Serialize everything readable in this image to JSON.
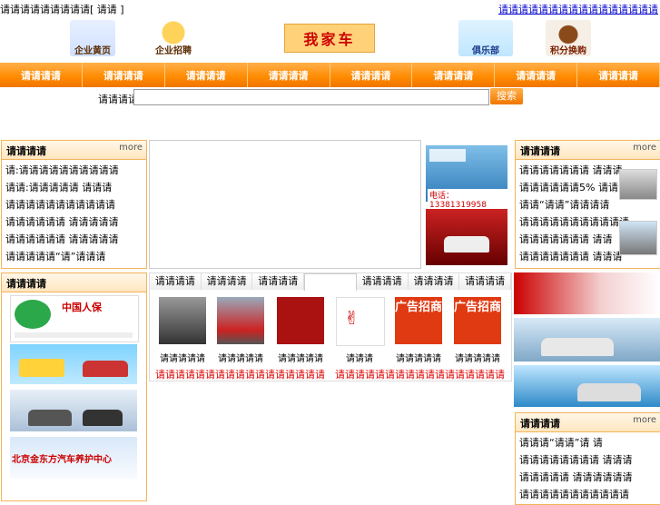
{
  "topbar": {
    "left": "请请请请请请请请请[ 请请 ]",
    "right": "请请请请请请请请请请请请请请请请"
  },
  "header": {
    "logos": [
      "企业黄页",
      "企业招聘",
      "我家车",
      "俱乐部",
      "积分换购"
    ]
  },
  "nav": [
    "请请请请",
    "请请请请",
    "请请请请",
    "请请请请",
    "请请请请",
    "请请请请",
    "请请请请",
    "请请请请"
  ],
  "search": {
    "label": "请请请请",
    "button": "搜索",
    "value": ""
  },
  "left_top": {
    "title": "请请请请",
    "more": "more",
    "items": [
      "请:请请请请请请请请请请",
      "请请:请请请请请 请请请",
      "请请请请请请请请请请请",
      "请请请请请请 请请请请请",
      "请请请请请请 请请请请请",
      "请请请请请“请”请请请"
    ]
  },
  "left_ads": {
    "title": "请请请请",
    "ad_text": [
      "中国人保",
      "北京金东方汽车养护中心"
    ]
  },
  "center_ads": {
    "phone": "电话：13381319958"
  },
  "center_tabs": [
    "请请请请",
    "请请请请",
    "请请请请",
    "",
    "请请请请",
    "请请请请",
    "请请请请"
  ],
  "center_products": [
    {
      "name": "请请请请请"
    },
    {
      "name": "请请请请请"
    },
    {
      "name": "请请请请请"
    },
    {
      "name": "请请请"
    },
    {
      "name": "请请请请请",
      "ad": "广告招商"
    },
    {
      "name": "请请请请请",
      "ad": "广告招商"
    }
  ],
  "center_links": [
    "请请请请请请请请请请请请请请请请请",
    "请请请请请请请请请请请请请请请请请"
  ],
  "right_top": {
    "title": "请请请请",
    "more": "more",
    "items": [
      "请请请请请请请 请请请",
      "请请请请请请5% 请请",
      "请请“请请”请请请请",
      "请请请请请请请请请请请",
      "请请请请请请请 请请",
      "请请请请请请请 请请请"
    ]
  },
  "right_bottom": {
    "title": "请请请请",
    "more": "more",
    "items": [
      "请请请“请请”请 请",
      "请请请请请请请请 请请请",
      "请请请请请 请请请请请请",
      "请请请请请请请请请请请"
    ]
  },
  "colors": {
    "accent": "#ff8a00",
    "border": "#f5b35a",
    "link": "#0000cc",
    "red": "#dd0000"
  }
}
